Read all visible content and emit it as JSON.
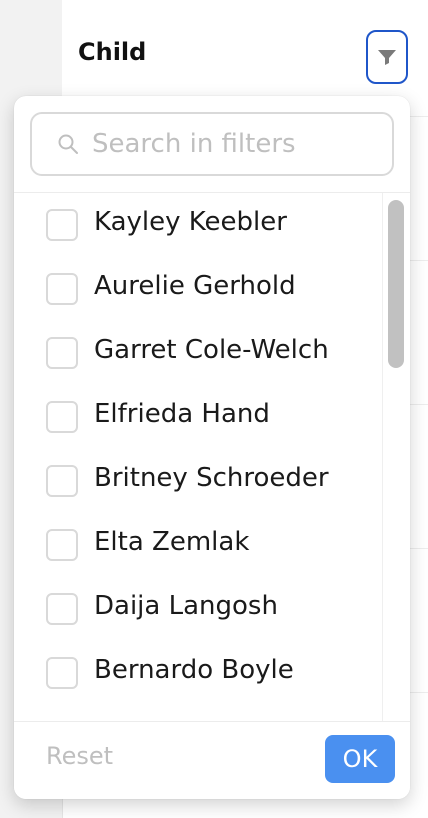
{
  "column": {
    "title": "Child",
    "filter_icon": "filter-icon"
  },
  "dropdown": {
    "search": {
      "placeholder": "Search in filters",
      "value": "",
      "icon": "search-icon"
    },
    "items": [
      {
        "label": "Kayley Keebler",
        "checked": false
      },
      {
        "label": "Aurelie Gerhold",
        "checked": false
      },
      {
        "label": "Garret Cole-Welch",
        "checked": false
      },
      {
        "label": "Elfrieda Hand",
        "checked": false
      },
      {
        "label": "Britney Schroeder",
        "checked": false
      },
      {
        "label": "Elta Zemlak",
        "checked": false
      },
      {
        "label": "Daija Langosh",
        "checked": false
      },
      {
        "label": "Bernardo Boyle",
        "checked": false
      }
    ],
    "footer": {
      "reset_label": "Reset",
      "ok_label": "OK"
    }
  },
  "colors": {
    "accent": "#4a90f0",
    "filter_focus_border": "#1f56c9"
  }
}
